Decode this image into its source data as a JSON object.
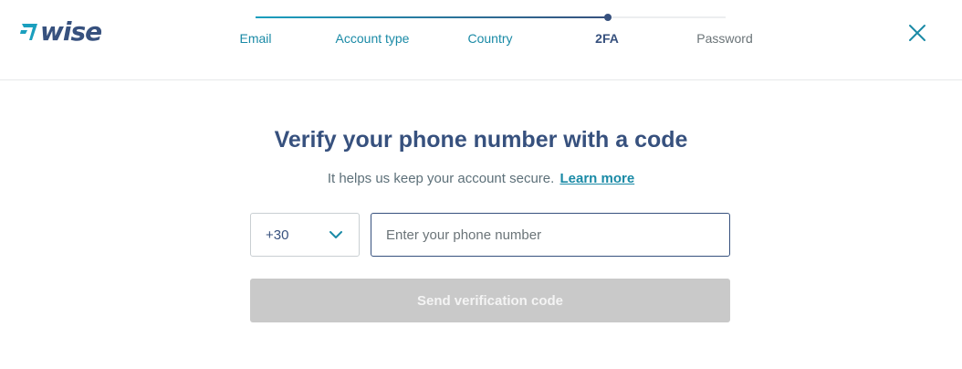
{
  "brand": {
    "name": "wise"
  },
  "progress": {
    "steps": [
      {
        "label": "Email",
        "status": "done"
      },
      {
        "label": "Account type",
        "status": "done"
      },
      {
        "label": "Country",
        "status": "done"
      },
      {
        "label": "2FA",
        "status": "current"
      },
      {
        "label": "Password",
        "status": "todo"
      }
    ],
    "current_step": 4,
    "total_steps": 5
  },
  "header": {
    "close_icon": "close-icon"
  },
  "main": {
    "title": "Verify your phone number with a code",
    "subtitle": "It helps us keep your account secure.",
    "learn_more": "Learn more",
    "country_code": {
      "value": "+30",
      "icon": "chevron-down-icon"
    },
    "phone": {
      "value": "",
      "placeholder": "Enter your phone number"
    },
    "send_button": "Send verification code"
  },
  "colors": {
    "brand_navy": "#37517e",
    "brand_teal": "#1a8aa6",
    "disabled_button": "#c9c9c9"
  }
}
